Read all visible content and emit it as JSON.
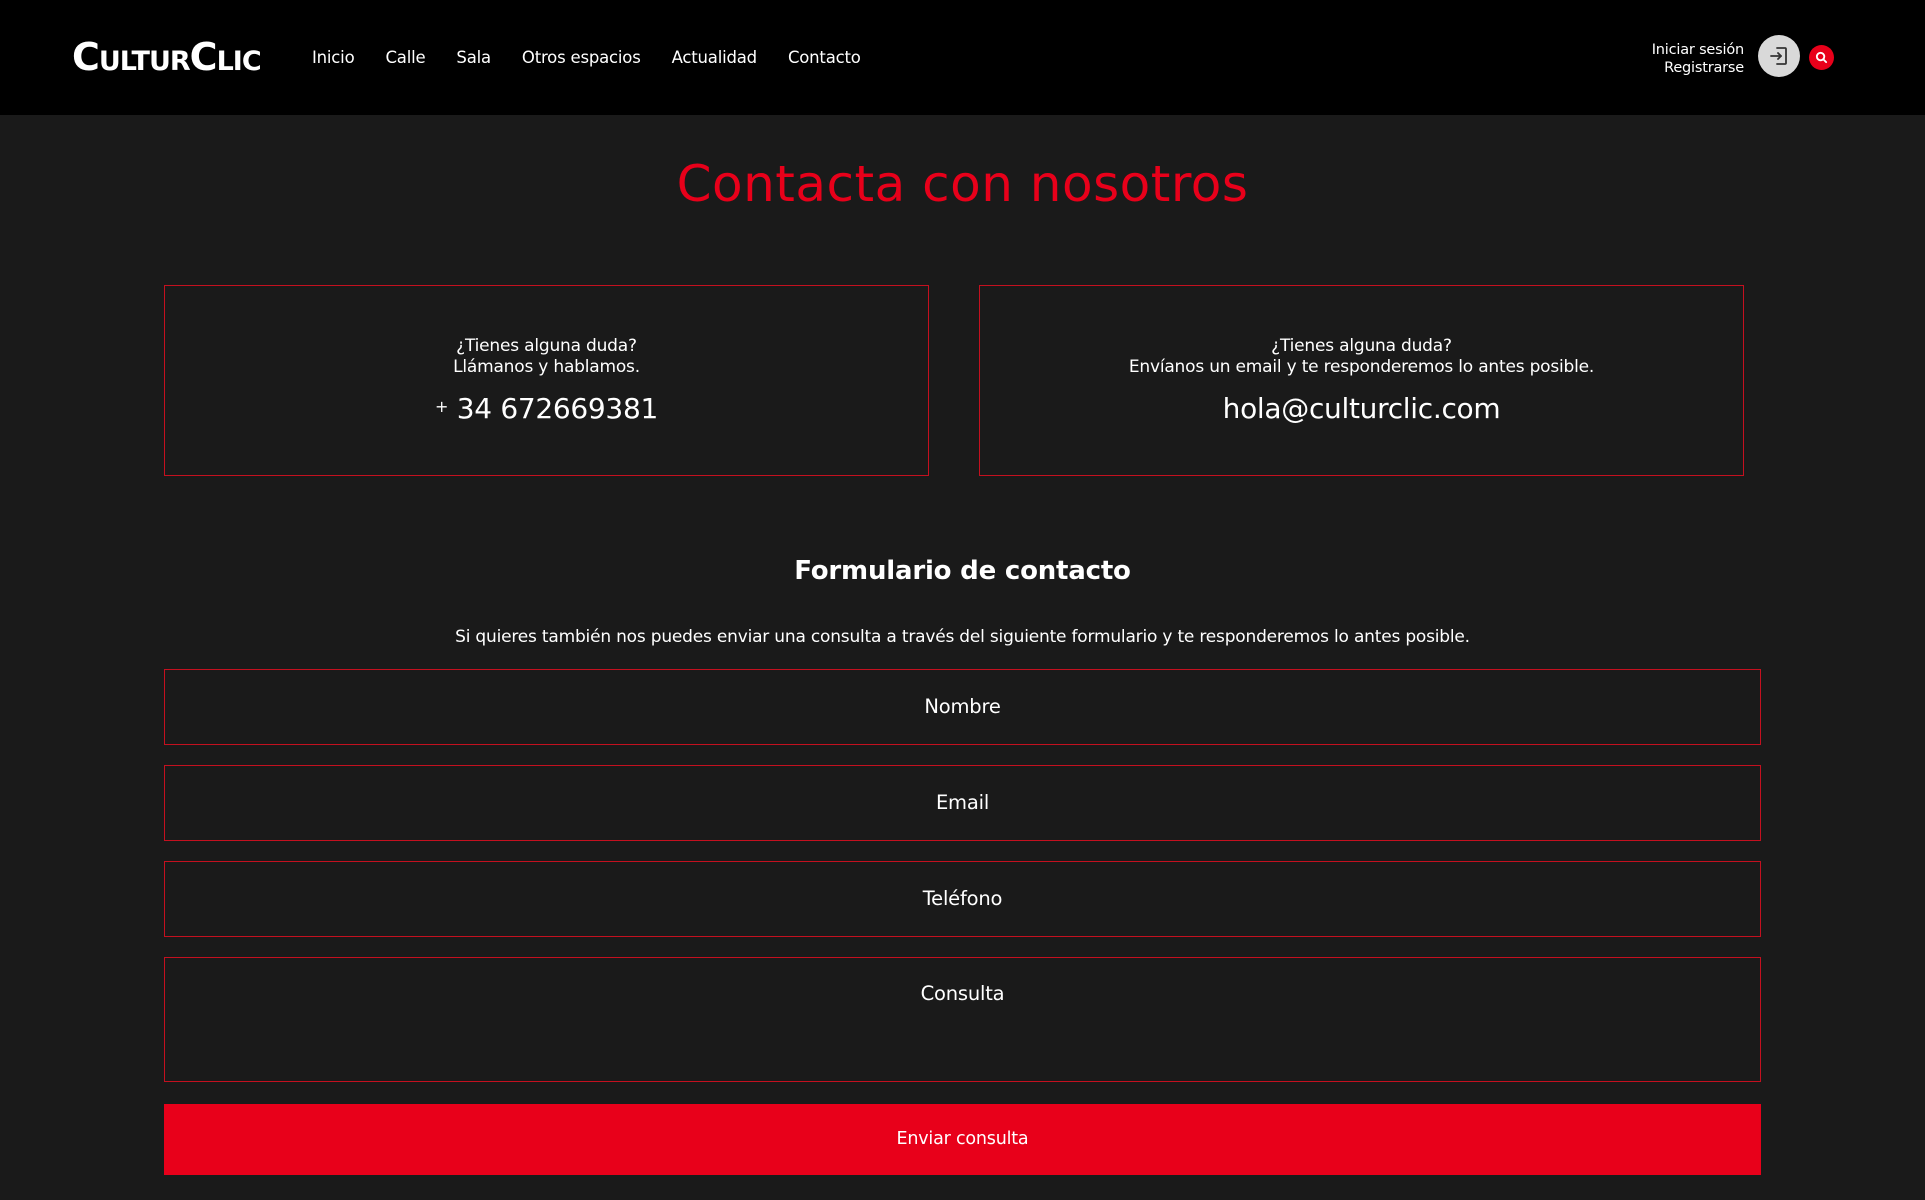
{
  "brand": {
    "logo_text": "CulturClic",
    "accent_color": "#e8001a"
  },
  "nav": {
    "items": [
      {
        "label": "Inicio"
      },
      {
        "label": "Calle"
      },
      {
        "label": "Sala"
      },
      {
        "label": "Otros espacios"
      },
      {
        "label": "Actualidad"
      },
      {
        "label": "Contacto"
      }
    ]
  },
  "auth": {
    "login_label": "Iniciar sesión",
    "register_label": "Registrarse",
    "login_icon": "login-arrow-icon",
    "search_icon": "search-icon"
  },
  "page": {
    "title": "Contacta con nosotros"
  },
  "cards": {
    "phone": {
      "question": "¿Tienes alguna duda?",
      "text": "Llámanos y hablamos.",
      "plus": "+",
      "value": "34 672669381"
    },
    "email": {
      "question": "¿Tienes alguna duda?",
      "text": "Envíanos un email y te responderemos lo antes posible.",
      "value": "hola@culturclic.com"
    }
  },
  "form": {
    "title": "Formulario de contacto",
    "subtitle": "Si quieres también nos puedes enviar una consulta a través del siguiente formulario y te responderemos lo antes posible.",
    "name_placeholder": "Nombre",
    "email_placeholder": "Email",
    "phone_placeholder": "Teléfono",
    "query_placeholder": "Consulta",
    "submit_label": "Enviar consulta"
  }
}
